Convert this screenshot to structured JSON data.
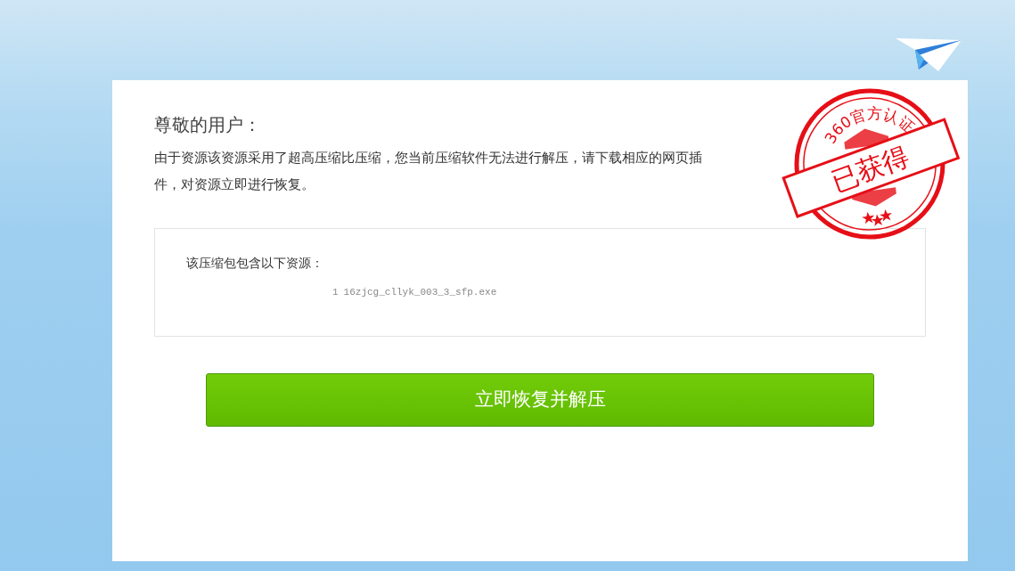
{
  "greeting": "尊敬的用户：",
  "message": "由于资源该资源采用了超高压缩比压缩，您当前压缩软件无法进行解压，请下载相应的网页插件，对资源立即进行恢复。",
  "stamp": {
    "ring_text": "360官方认证",
    "banner": "已获得"
  },
  "archive": {
    "heading": "该压缩包包含以下资源：",
    "files": [
      {
        "index": "1",
        "name": "16zjcg_cllyk_003_3_sfp.exe"
      }
    ]
  },
  "action_button": "立即恢复并解压"
}
